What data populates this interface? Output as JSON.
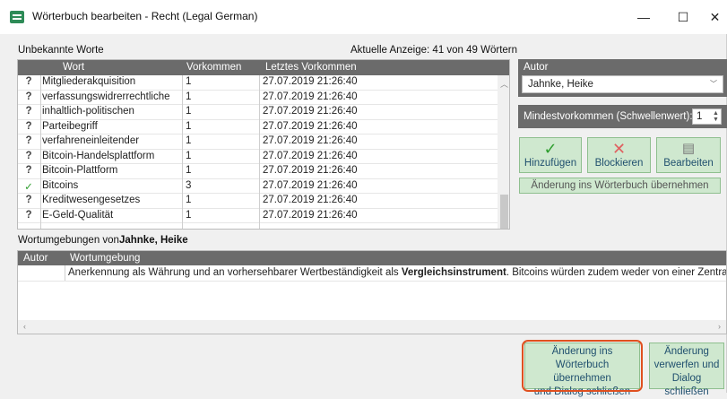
{
  "window": {
    "title": "Wörterbuch bearbeiten - Recht (Legal German)",
    "minimize": "—",
    "maximize": "☐",
    "close": "✕"
  },
  "unknown": {
    "label": "Unbekannte Worte",
    "count_text": "Aktuelle Anzeige: 41 von 49 Wörtern",
    "columns": [
      "Wort",
      "Vorkommen",
      "Letztes Vorkommen"
    ],
    "rows": [
      {
        "status": "?",
        "word": "Mitgliederakquisition",
        "count": "1",
        "last": "27.07.2019 21:26:40"
      },
      {
        "status": "?",
        "word": "verfassungswidrerrechtliche",
        "count": "1",
        "last": "27.07.2019 21:26:40"
      },
      {
        "status": "?",
        "word": "inhaltlich-politischen",
        "count": "1",
        "last": "27.07.2019 21:26:40"
      },
      {
        "status": "?",
        "word": "Parteibegriff",
        "count": "1",
        "last": "27.07.2019 21:26:40"
      },
      {
        "status": "?",
        "word": "verfahreneinleitender",
        "count": "1",
        "last": "27.07.2019 21:26:40"
      },
      {
        "status": "?",
        "word": "Bitcoin-Handelsplattform",
        "count": "1",
        "last": "27.07.2019 21:26:40"
      },
      {
        "status": "?",
        "word": "Bitcoin-Plattform",
        "count": "1",
        "last": "27.07.2019 21:26:40"
      },
      {
        "status": "✓",
        "word": "Bitcoins",
        "count": "3",
        "last": "27.07.2019 21:26:40"
      },
      {
        "status": "?",
        "word": "Kreditwesengesetzes",
        "count": "1",
        "last": "27.07.2019 21:26:40"
      },
      {
        "status": "?",
        "word": "E-Geld-Qualität",
        "count": "1",
        "last": "27.07.2019 21:26:40"
      }
    ]
  },
  "author": {
    "label": "Autor",
    "selected": "Jahnke, Heike"
  },
  "min_occurrences": {
    "label": "Mindestvorkommen (Schwellenwert):",
    "value": "1"
  },
  "actions": {
    "add": "Hinzufügen",
    "block": "Blockieren",
    "edit": "Bearbeiten",
    "apply": "Änderung ins Wörterbuch übernehmen"
  },
  "context": {
    "label_prefix": "Wortumgebungen von",
    "label_author": "Jahnke, Heike",
    "columns": [
      "Autor",
      "Wortumgebung"
    ],
    "text_before": "Anerkennung als Währung und an vorhersehbarer Wertbeständigkeit als ",
    "text_bold": "Vergleichsinstrument",
    "text_after": ". Bitcoins würden zudem weder von einer Zentralbank"
  },
  "bottom": {
    "apply_close": [
      "Änderung ins",
      "Wörterbuch übernehmen",
      "und Dialog schließen"
    ],
    "discard_close": [
      "Änderung",
      "verwerfen und",
      "Dialog schließen"
    ]
  }
}
